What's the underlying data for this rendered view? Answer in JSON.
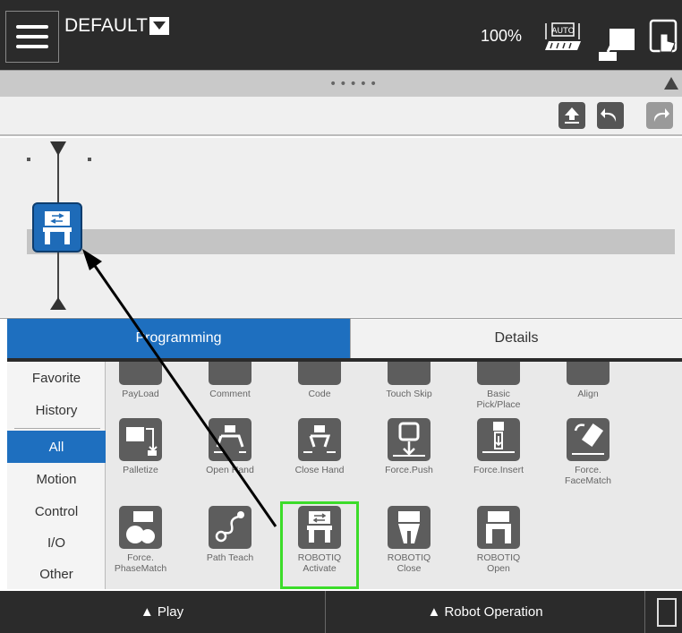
{
  "header": {
    "title": "DEFAULT",
    "speed": "100%",
    "auto_label": "AUTO"
  },
  "collapse_bar": {
    "dots": "•••••"
  },
  "tabs": [
    {
      "label": "Programming",
      "active": true
    },
    {
      "label": "Details",
      "active": false
    }
  ],
  "categories": [
    {
      "label": "Favorite"
    },
    {
      "label": "History"
    },
    {
      "label": "All",
      "active": true
    },
    {
      "label": "Motion"
    },
    {
      "label": "Control"
    },
    {
      "label": "I/O"
    },
    {
      "label": "Other"
    }
  ],
  "palette": {
    "row1": [
      "PayLoad",
      "Comment",
      "Code",
      "Touch Skip",
      "Basic\nPick/Place",
      "Align"
    ],
    "row2": [
      "Palletize",
      "Open Hand",
      "Close Hand",
      "Force.Push",
      "Force.Insert",
      "Force.\nFaceMatch"
    ],
    "row3": [
      "Force.\nPhaseMatch",
      "Path Teach",
      "ROBOTIQ\nActivate",
      "ROBOTIQ\nClose",
      "ROBOTIQ\nOpen"
    ]
  },
  "bottom": {
    "play_label": "▲ Play",
    "robot_op_label": "▲ Robot Operation"
  },
  "colors": {
    "accent": "#1e6fbf",
    "highlight": "#3cdc2a",
    "topbar": "#2b2b2b"
  }
}
